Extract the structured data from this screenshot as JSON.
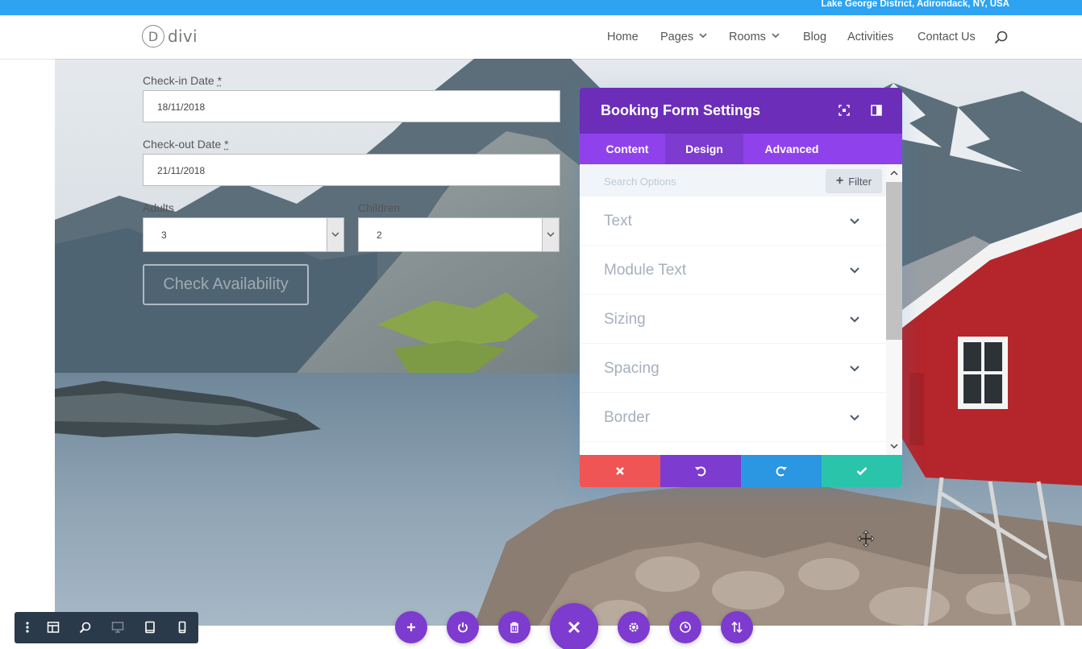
{
  "topbar": {
    "location": "Lake George District, Adirondack, NY, USA"
  },
  "header": {
    "logo_text": "divi",
    "logo_letter": "D",
    "nav": [
      {
        "label": "Home",
        "has_dropdown": false
      },
      {
        "label": "Pages",
        "has_dropdown": true
      },
      {
        "label": "Rooms",
        "has_dropdown": true
      },
      {
        "label": "Blog",
        "has_dropdown": false
      },
      {
        "label": "Activities",
        "has_dropdown": false
      },
      {
        "label": "Contact Us",
        "has_dropdown": false
      }
    ]
  },
  "form": {
    "checkin_label": "Check-in Date",
    "checkin_value": "18/11/2018",
    "checkout_label": "Check-out Date",
    "checkout_value": "21/11/2018",
    "required_mark": "*",
    "adults_label": "Adults",
    "adults_value": "3",
    "children_label": "Children",
    "children_value": "2",
    "check_button": "Check Availability"
  },
  "panel": {
    "title": "Booking Form Settings",
    "tabs": [
      {
        "label": "Content",
        "active": false
      },
      {
        "label": "Design",
        "active": true
      },
      {
        "label": "Advanced",
        "active": false
      }
    ],
    "search_placeholder": "Search Options",
    "filter_label": "Filter",
    "options": [
      {
        "label": "Text"
      },
      {
        "label": "Module Text"
      },
      {
        "label": "Sizing"
      },
      {
        "label": "Spacing"
      },
      {
        "label": "Border"
      }
    ]
  },
  "colors": {
    "topbar": "#2ea3f2",
    "panel_header": "#6c2eb9",
    "panel_tabs": "#8f42ec",
    "active_tab": "#7d3bcf",
    "cancel": "#ef5555",
    "undo": "#7d3bcf",
    "redo": "#2b96e1",
    "save": "#29c4a9",
    "builder_bar": "#2b3a4a"
  },
  "icons": {
    "left_toolbar": [
      "menu-dots-icon",
      "layout-icon",
      "zoom-icon",
      "desktop-icon",
      "tablet-icon",
      "phone-icon"
    ],
    "bottom_center": [
      "add-icon",
      "power-icon",
      "trash-icon",
      "close-icon",
      "gear-icon",
      "history-icon",
      "sort-icon"
    ]
  }
}
